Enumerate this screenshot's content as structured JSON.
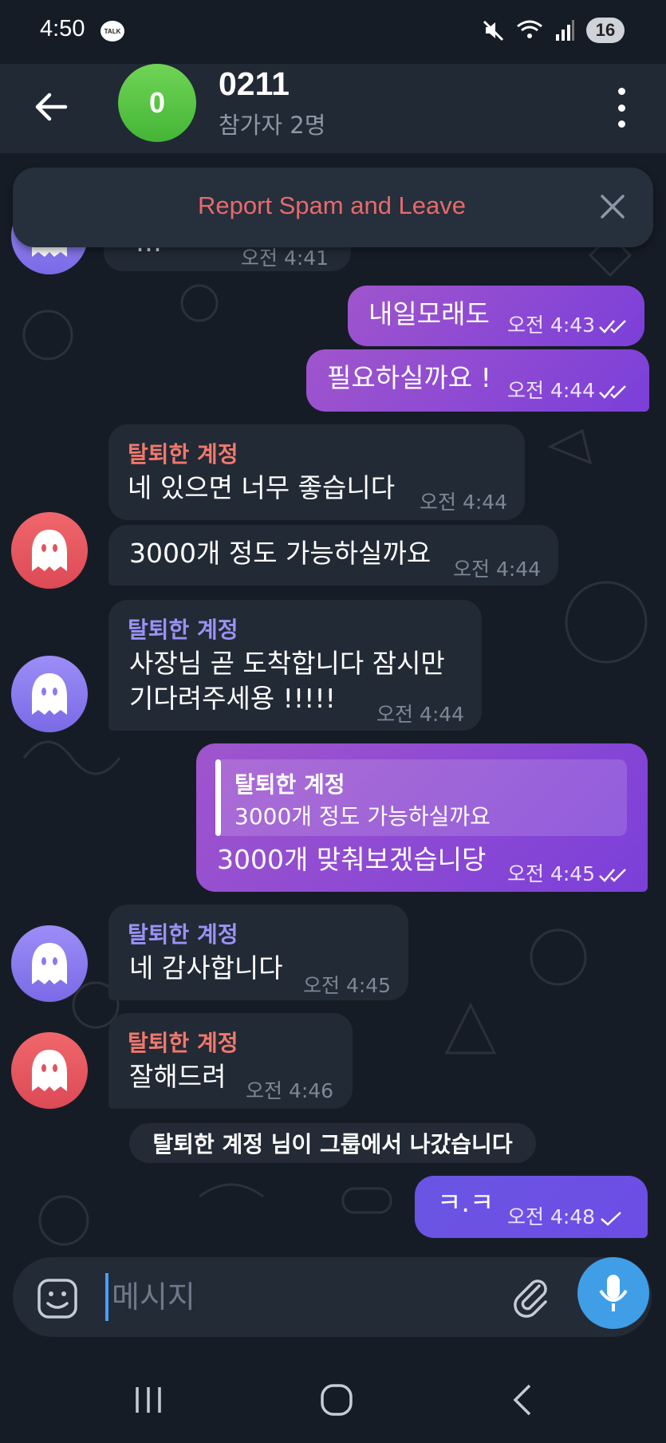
{
  "status_bar": {
    "time": "4:50",
    "talk_badge": "TALK",
    "battery_level": "16"
  },
  "header": {
    "avatar_letter": "0",
    "title": "0211",
    "subtitle": "참가자 2명"
  },
  "spam_banner": {
    "label": "Report Spam and Leave"
  },
  "messages": [
    {
      "text": "…",
      "time": "오전 4:41"
    },
    {
      "text": "내일모래도",
      "time": "오전 4:43",
      "status": "read"
    },
    {
      "text": "필요하실까요 !",
      "time": "오전 4:44",
      "status": "read"
    },
    {
      "sender": "탈퇴한 계정",
      "text": "네 있으면 너무 좋습니다",
      "time": "오전 4:44"
    },
    {
      "text": "3000개 정도 가능하실까요",
      "time": "오전 4:44"
    },
    {
      "sender": "탈퇴한 계정",
      "text": "사장님 곧 도착합니다 잠시만\n기다려주세용 !!!!!",
      "time": "오전 4:44"
    },
    {
      "reply_name": "탈퇴한 계정",
      "reply_text": "3000개 정도 가능하실까요",
      "text": "3000개 맞춰보겠습니당",
      "time": "오전 4:45",
      "status": "read"
    },
    {
      "sender": "탈퇴한 계정",
      "text": "네 감사합니다",
      "time": "오전 4:45"
    },
    {
      "sender": "탈퇴한 계정",
      "text": "잘해드려",
      "time": "오전 4:46"
    },
    {
      "text": "ㅋ.ㅋ",
      "time": "오전 4:48",
      "status": "sent"
    }
  ],
  "system_message": "탈퇴한 계정 님이 그룹에서 나갔습니다",
  "composer": {
    "placeholder": "메시지"
  },
  "colors": {
    "sender_red": "#f1786c",
    "sender_purple": "#9a92f5",
    "out_bubble": "#8a47d2",
    "mic": "#3f9ee6",
    "spam_text": "#e9696c"
  }
}
